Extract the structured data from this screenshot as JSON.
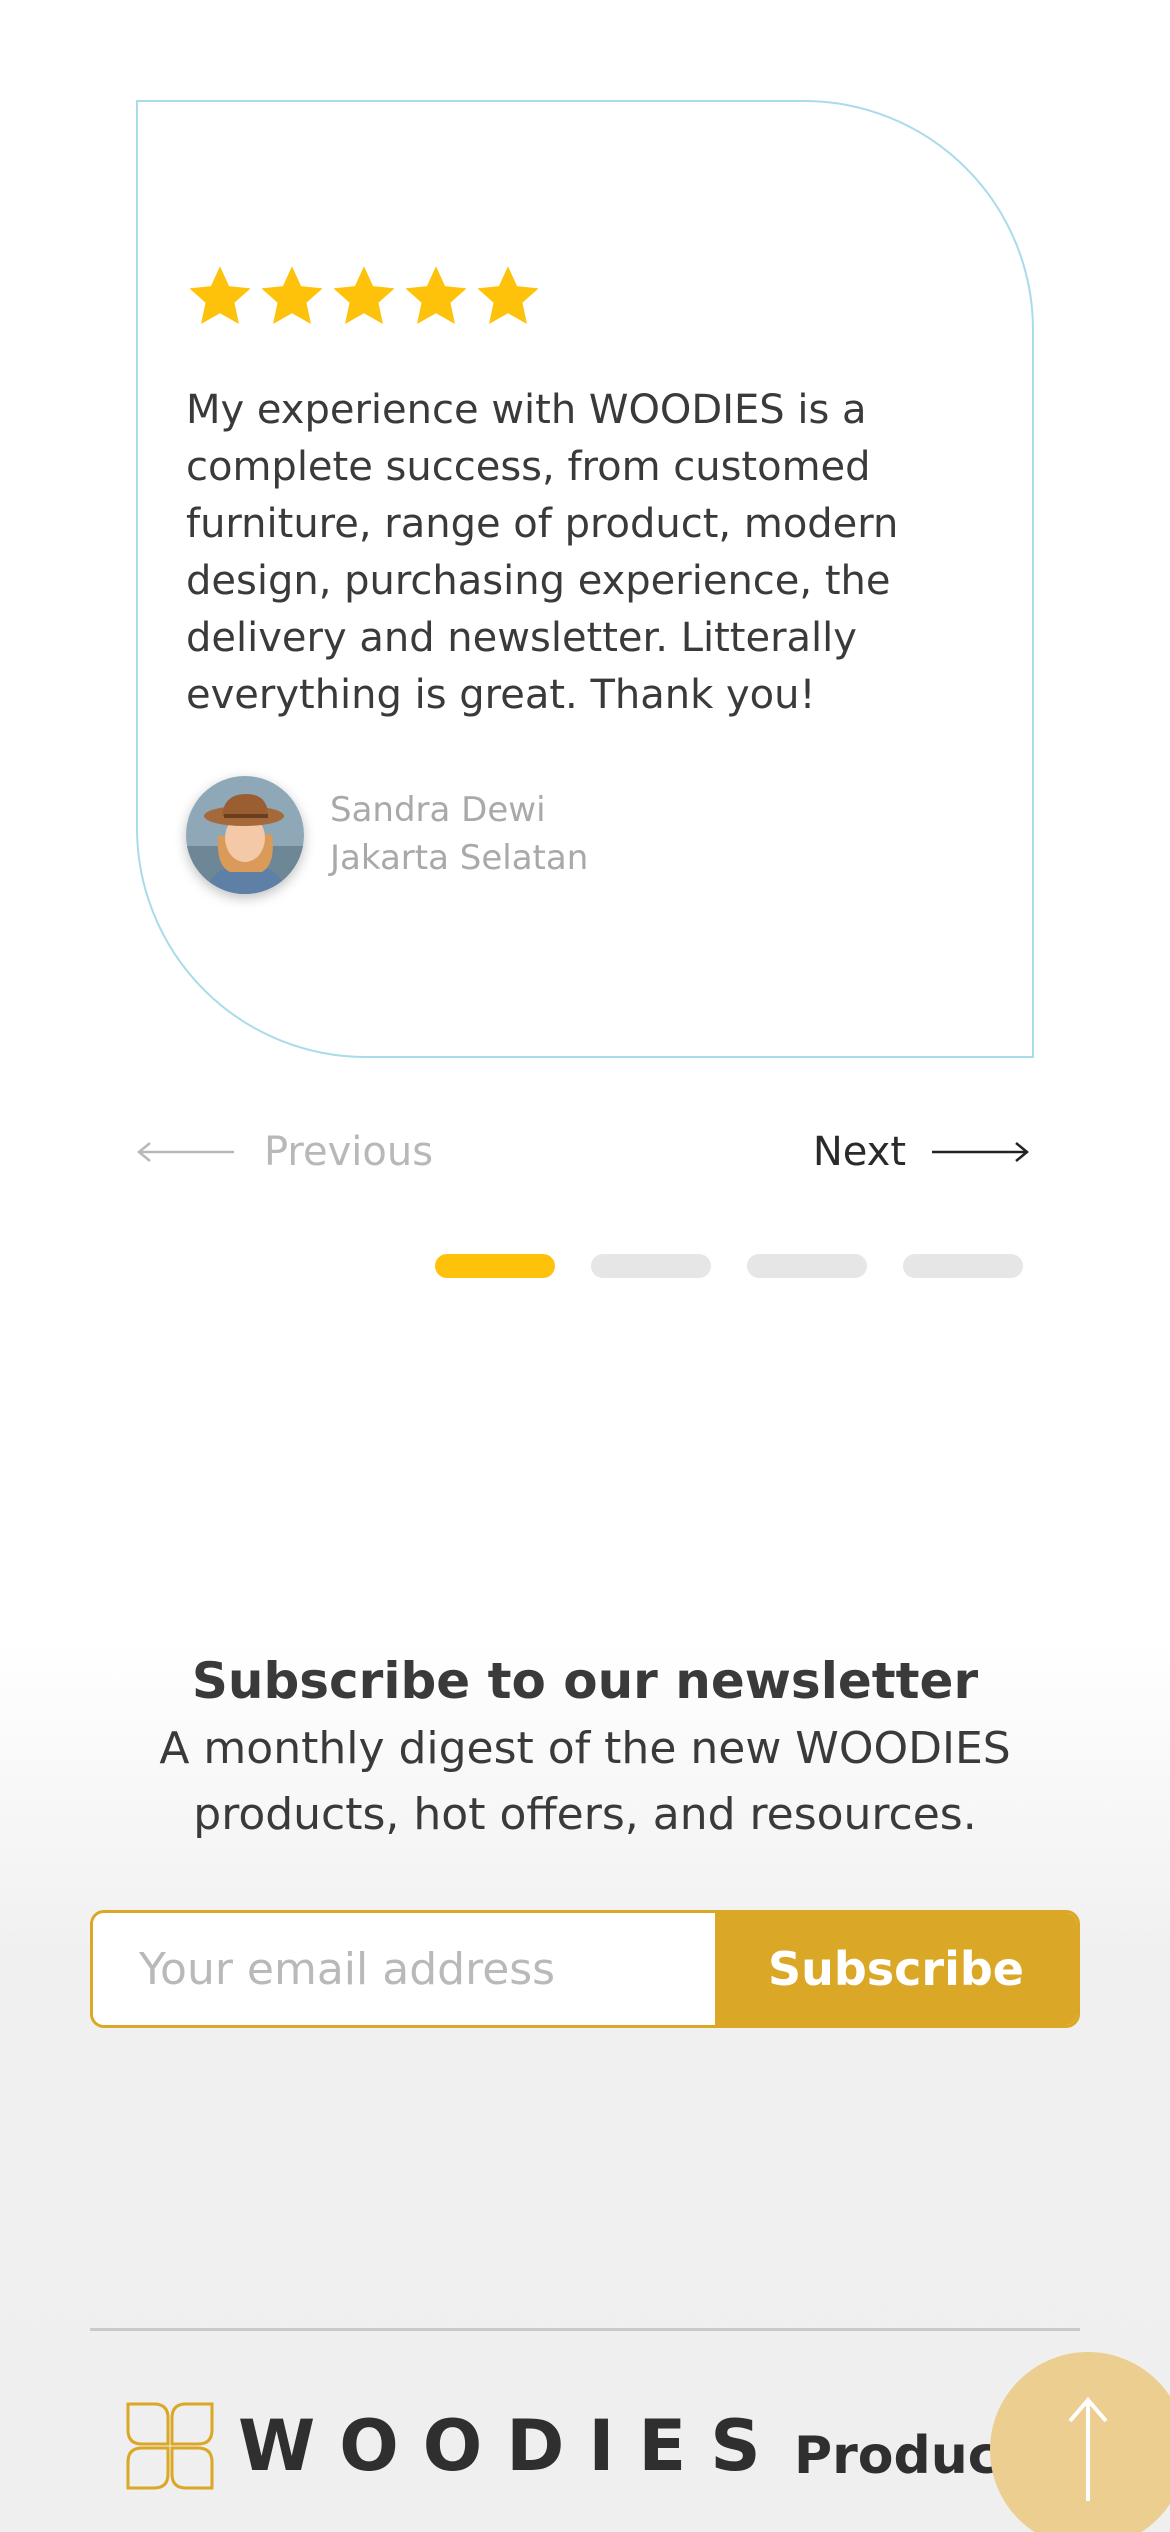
{
  "testimonial": {
    "rating": 5,
    "rating_max": 5,
    "quote": "My experience with WOODIES is a complete success, from customed furniture, range of product, modern design, purchasing experience, the delivery and newsletter. Litterally everything is great. Thank you!",
    "author_name": "Sandra Dewi",
    "author_location": "Jakarta Selatan",
    "star_color": "#ffc20a"
  },
  "carousel": {
    "previous_label": "Previous",
    "next_label": "Next",
    "slide_count": 4,
    "active_index": 0
  },
  "newsletter": {
    "title": "Subscribe to our newsletter",
    "description": "A monthly digest of the new WOODIES products, hot offers, and resources.",
    "email_placeholder": "Your email address",
    "subscribe_label": "Subscribe",
    "accent_color": "#dba726"
  },
  "footer": {
    "brand": "WOODIES",
    "product_heading": "Product"
  },
  "icons": {
    "star": "star-icon",
    "prev": "arrow-left-icon",
    "next": "arrow-right-icon",
    "to_top": "arrow-up-icon",
    "logo": "woodies-logo-icon"
  }
}
